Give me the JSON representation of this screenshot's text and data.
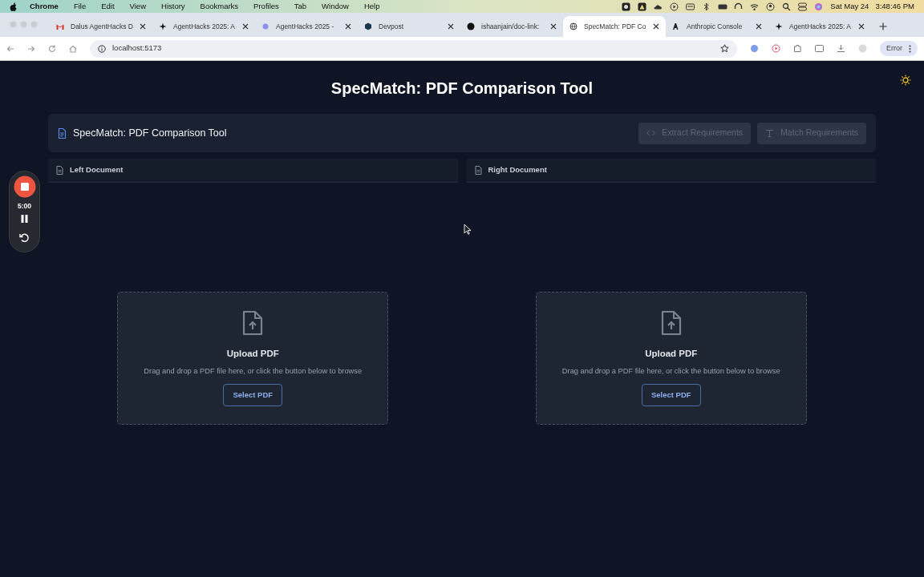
{
  "menubar": {
    "app": "Chrome",
    "menus": [
      "File",
      "Edit",
      "View",
      "History",
      "Bookmarks",
      "Profiles",
      "Tab",
      "Window",
      "Help"
    ],
    "date": "Sat May 24",
    "time": "3:48:46 PM"
  },
  "browser": {
    "tabs": [
      {
        "title": "Dalus AgentHacks D",
        "kind": "mail",
        "selected": false
      },
      {
        "title": "AgentHacks 2025: A",
        "kind": "spark",
        "selected": false
      },
      {
        "title": "AgentHacks 2025 - ",
        "kind": "dot",
        "selected": false
      },
      {
        "title": "Devpost",
        "kind": "hex",
        "selected": false
      },
      {
        "title": "ishaanjain/doc-link: ",
        "kind": "cat",
        "selected": false
      },
      {
        "title": "SpecMatch: PDF Co",
        "kind": "globe",
        "selected": true
      },
      {
        "title": "Anthropic Console",
        "kind": "anthropic",
        "selected": false
      },
      {
        "title": "AgentHacks 2025: A",
        "kind": "spark",
        "selected": false
      }
    ],
    "address": "localhost:5173",
    "profile_button": "Error"
  },
  "page": {
    "title": "SpecMatch: PDF Comparison Tool",
    "toolbar": {
      "title": "SpecMatch: PDF Comparison Tool",
      "buttons": [
        {
          "label": "Extract Requirements",
          "kind": "code",
          "disabled": true
        },
        {
          "label": "Match Requirements",
          "kind": "text",
          "disabled": true
        }
      ]
    },
    "panels": [
      {
        "title": "Left Document",
        "dropzone": {
          "heading": "Upload PDF",
          "hint": "Drag and drop a PDF file here, or click the button below to browse",
          "button": "Select PDF"
        }
      },
      {
        "title": "Right Document",
        "dropzone": {
          "heading": "Upload PDF",
          "hint": "Drag and drop a PDF file here, or click the button below to browse",
          "button": "Select PDF"
        }
      }
    ]
  },
  "recorder": {
    "timer": "5:00"
  }
}
